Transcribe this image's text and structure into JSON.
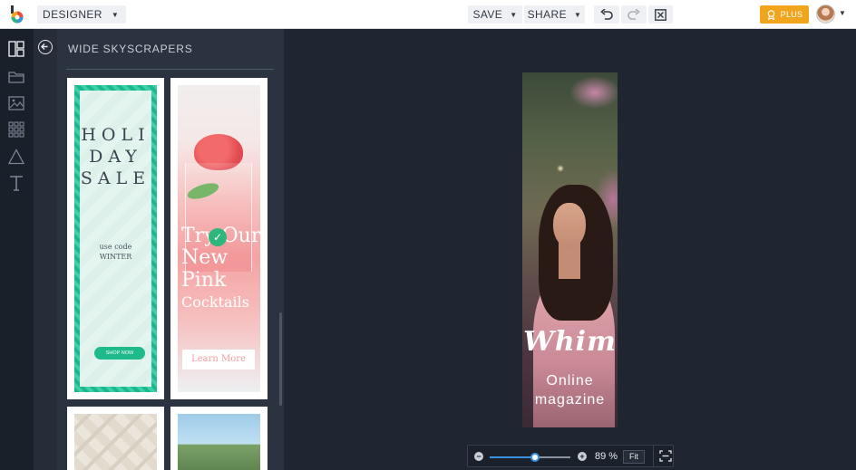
{
  "topbar": {
    "mode_label": "DESIGNER",
    "save_label": "SAVE",
    "share_label": "SHARE",
    "plus_label": "PLUS"
  },
  "panel": {
    "title": "WIDE SKYSCRAPERS",
    "templates": [
      {
        "lines": [
          "HOLI",
          "DAY",
          "SALE"
        ],
        "code_line1": "use code",
        "code_line2": "WINTER",
        "button": "SHOP NOW"
      },
      {
        "lines": [
          "Try Our",
          "New",
          "Pink",
          "Cocktails"
        ],
        "button": "Learn More",
        "selected": true
      },
      {},
      {}
    ]
  },
  "canvas": {
    "banner_title": "Whim",
    "banner_sub1": "Online",
    "banner_sub2": "magazine"
  },
  "zoom": {
    "value_label": "89 %",
    "level": 0.56,
    "fit_label": "Fit"
  },
  "colors": {
    "accent": "#3b93e0",
    "plus": "#f1a51d",
    "canvas_bg": "#1f2631",
    "panel_bg": "#2b3340"
  }
}
